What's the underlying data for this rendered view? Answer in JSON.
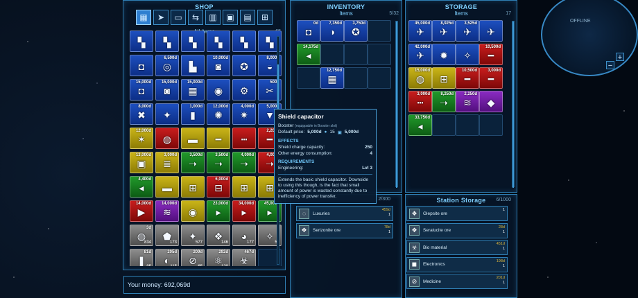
{
  "shop": {
    "title": "SHOP",
    "subtitle": "All items",
    "count": "65",
    "tabs": [
      {
        "icon": "grid-icon",
        "glyph": "▦"
      },
      {
        "icon": "ship-icon",
        "glyph": "➤"
      },
      {
        "icon": "gun-icon",
        "glyph": "▭"
      },
      {
        "icon": "arrows-icon",
        "glyph": "⇆"
      },
      {
        "icon": "engine-icon",
        "glyph": "▥"
      },
      {
        "icon": "boxes-icon",
        "glyph": "▣"
      },
      {
        "icon": "bars-icon",
        "glyph": "▤"
      },
      {
        "icon": "crates-icon",
        "glyph": "⊞"
      }
    ],
    "items": [
      {
        "color": "blue",
        "price": "",
        "icon": "▚",
        "qty": ""
      },
      {
        "color": "blue",
        "price": "",
        "icon": "▚",
        "qty": ""
      },
      {
        "color": "blue",
        "price": "",
        "icon": "▚",
        "qty": ""
      },
      {
        "color": "blue",
        "price": "",
        "icon": "▚",
        "qty": ""
      },
      {
        "color": "blue",
        "price": "",
        "icon": "▚",
        "qty": ""
      },
      {
        "color": "blue",
        "price": "",
        "icon": "▚",
        "qty": ""
      },
      {
        "color": "blue",
        "price": "",
        "icon": "◘",
        "qty": ""
      },
      {
        "color": "blue",
        "price": "6,500d",
        "icon": "◎",
        "qty": ""
      },
      {
        "color": "blue",
        "price": "",
        "icon": "▙",
        "qty": ""
      },
      {
        "color": "blue",
        "price": "10,000d",
        "icon": "◙",
        "qty": ""
      },
      {
        "color": "blue",
        "price": "",
        "icon": "✪",
        "qty": ""
      },
      {
        "color": "blue",
        "price": "8,000d",
        "icon": "◒",
        "qty": ""
      },
      {
        "color": "blue",
        "price": "15,000d",
        "icon": "◘",
        "qty": ""
      },
      {
        "color": "blue",
        "price": "15,000d",
        "icon": "◙",
        "qty": ""
      },
      {
        "color": "blue",
        "price": "15,000d",
        "icon": "▦",
        "qty": ""
      },
      {
        "color": "blue",
        "price": "",
        "icon": "◉",
        "qty": ""
      },
      {
        "color": "blue",
        "price": "",
        "icon": "⚙",
        "qty": ""
      },
      {
        "color": "blue",
        "price": "500d",
        "icon": "✂",
        "qty": ""
      },
      {
        "color": "blue",
        "price": "8,000d",
        "icon": "✖",
        "qty": ""
      },
      {
        "color": "blue",
        "price": "",
        "icon": "✦",
        "qty": ""
      },
      {
        "color": "blue",
        "price": "1,000d",
        "icon": "▮",
        "qty": ""
      },
      {
        "color": "blue",
        "price": "12,000d",
        "icon": "✺",
        "qty": ""
      },
      {
        "color": "blue",
        "price": "4,000d",
        "icon": "✷",
        "qty": ""
      },
      {
        "color": "blue",
        "price": "5,000d",
        "icon": "▼",
        "qty": ""
      },
      {
        "color": "yellow",
        "price": "12,000d",
        "icon": "✶",
        "qty": ""
      },
      {
        "color": "red",
        "price": "",
        "icon": "◍",
        "qty": ""
      },
      {
        "color": "yellow",
        "price": "",
        "icon": "▬",
        "qty": ""
      },
      {
        "color": "yellow",
        "price": "",
        "icon": "━",
        "qty": ""
      },
      {
        "color": "red",
        "price": "",
        "icon": "┅",
        "qty": ""
      },
      {
        "color": "red",
        "price": "2,200d",
        "icon": "━",
        "qty": ""
      },
      {
        "color": "yellow",
        "price": "13,000d",
        "icon": "▣",
        "qty": ""
      },
      {
        "color": "yellow",
        "price": "3,000d",
        "icon": "≣",
        "qty": ""
      },
      {
        "color": "green",
        "price": "3,500d",
        "icon": "➝",
        "qty": ""
      },
      {
        "color": "green",
        "price": "3,500d",
        "icon": "➝",
        "qty": ""
      },
      {
        "color": "green",
        "price": "4,000d",
        "icon": "➝",
        "qty": ""
      },
      {
        "color": "red",
        "price": "4,000d",
        "icon": "➝",
        "qty": ""
      },
      {
        "color": "green",
        "price": "4,400d",
        "icon": "◂",
        "qty": ""
      },
      {
        "color": "yellow",
        "price": "",
        "icon": "▬",
        "qty": ""
      },
      {
        "color": "yellow",
        "price": "",
        "icon": "⊞",
        "qty": ""
      },
      {
        "color": "red",
        "price": "6,000d",
        "icon": "⊟",
        "qty": ""
      },
      {
        "color": "yellow",
        "price": "",
        "icon": "⊞",
        "qty": ""
      },
      {
        "color": "yellow",
        "price": "",
        "icon": "⊞",
        "qty": ""
      },
      {
        "color": "red",
        "price": "14,000d",
        "icon": "▶",
        "qty": ""
      },
      {
        "color": "purple",
        "price": "14,000d",
        "icon": "≋",
        "qty": ""
      },
      {
        "color": "yellow",
        "price": "",
        "icon": "◉",
        "qty": ""
      },
      {
        "color": "green",
        "price": "23,000d",
        "icon": "▸",
        "qty": ""
      },
      {
        "color": "red",
        "price": "34,000d",
        "icon": "▸",
        "qty": ""
      },
      {
        "color": "green",
        "price": "45,000d",
        "icon": "▸",
        "qty": ""
      },
      {
        "color": "gray",
        "price": "3d",
        "icon": "◍",
        "qty": "834"
      },
      {
        "color": "gray",
        "price": "",
        "icon": "⬟",
        "qty": "173"
      },
      {
        "color": "gray",
        "price": "",
        "icon": "✦",
        "qty": "577"
      },
      {
        "color": "gray",
        "price": "",
        "icon": "❖",
        "qty": "146"
      },
      {
        "color": "gray",
        "price": "",
        "icon": "◕",
        "qty": "177"
      },
      {
        "color": "gray",
        "price": "",
        "icon": "✧",
        "qty": "57"
      },
      {
        "color": "gray",
        "price": "81d",
        "icon": "❚",
        "qty": "95"
      },
      {
        "color": "gray",
        "price": "205d",
        "icon": "◐",
        "qty": "115"
      },
      {
        "color": "gray",
        "price": "209d",
        "icon": "⊘",
        "qty": "65"
      },
      {
        "color": "gray",
        "price": "292d",
        "icon": "⚛",
        "qty": "120"
      },
      {
        "color": "gray",
        "price": "467d",
        "icon": "☣",
        "qty": ""
      },
      {
        "color": "empty",
        "price": "",
        "icon": "",
        "qty": ""
      }
    ]
  },
  "inventory": {
    "title": "INVENTORY",
    "subtitle": "Items",
    "count": "5/32",
    "items": [
      {
        "color": "blue",
        "price": "0d",
        "icon": "◘",
        "qty": ""
      },
      {
        "color": "blue",
        "price": "7,350d",
        "icon": "◑",
        "qty": ""
      },
      {
        "color": "blue",
        "price": "3,750d",
        "icon": "✪",
        "qty": ""
      },
      {
        "color": "empty",
        "price": "",
        "icon": "",
        "qty": ""
      },
      {
        "color": "green",
        "price": "14,175d",
        "icon": "◂",
        "qty": ""
      },
      {
        "color": "empty",
        "price": "",
        "icon": "",
        "qty": ""
      },
      {
        "color": "empty",
        "price": "",
        "icon": "",
        "qty": ""
      },
      {
        "color": "empty",
        "price": "",
        "icon": "",
        "qty": ""
      },
      {
        "color": "empty",
        "price": "",
        "icon": "",
        "qty": ""
      },
      {
        "color": "blue",
        "price": "12,750d",
        "icon": "▦",
        "qty": ""
      },
      {
        "color": "empty",
        "price": "",
        "icon": "",
        "qty": ""
      },
      {
        "color": "empty",
        "price": "",
        "icon": "",
        "qty": ""
      }
    ],
    "cargo_count": "2/300",
    "cargo": [
      {
        "icon": "luxury-icon",
        "glyph": "◌",
        "name": "Luxuries",
        "amount": "459d",
        "qty": "1"
      },
      {
        "icon": "ore-icon",
        "glyph": "❖",
        "name": "Serizonite ore",
        "amount": "78d",
        "qty": "1"
      }
    ]
  },
  "storage": {
    "title": "STORAGE",
    "subtitle": "Items",
    "count": "17",
    "items": [
      {
        "color": "blue",
        "price": "45,000d",
        "icon": "✈",
        "qty": ""
      },
      {
        "color": "blue",
        "price": "8,925d",
        "icon": "✈",
        "qty": ""
      },
      {
        "color": "blue",
        "price": "3,525d",
        "icon": "✈",
        "qty": ""
      },
      {
        "color": "blue",
        "price": "",
        "icon": "✈",
        "qty": ""
      },
      {
        "color": "blue",
        "price": "42,000d",
        "icon": "✈",
        "qty": ""
      },
      {
        "color": "blue",
        "price": "",
        "icon": "✹",
        "qty": ""
      },
      {
        "color": "blue",
        "price": "",
        "icon": "✧",
        "qty": ""
      },
      {
        "color": "red",
        "price": "10,500d",
        "icon": "━",
        "qty": ""
      },
      {
        "color": "yellow",
        "price": "15,000d",
        "icon": "◍",
        "qty": ""
      },
      {
        "color": "yellow",
        "price": "",
        "icon": "⊞",
        "qty": ""
      },
      {
        "color": "red",
        "price": "10,500d",
        "icon": "━",
        "qty": ""
      },
      {
        "color": "red",
        "price": "3,000d",
        "icon": "━",
        "qty": ""
      },
      {
        "color": "red",
        "price": "3,000d",
        "icon": "┅",
        "qty": ""
      },
      {
        "color": "green",
        "price": "8,250d",
        "icon": "➝",
        "qty": ""
      },
      {
        "color": "purple",
        "price": "2,250d",
        "icon": "≋",
        "qty": ""
      },
      {
        "color": "purple",
        "price": "",
        "icon": "◆",
        "qty": ""
      },
      {
        "color": "green",
        "price": "33,750d",
        "icon": "◂",
        "qty": ""
      },
      {
        "color": "empty",
        "price": "",
        "icon": "",
        "qty": ""
      },
      {
        "color": "empty",
        "price": "",
        "icon": "",
        "qty": ""
      },
      {
        "color": "empty",
        "price": "",
        "icon": "",
        "qty": ""
      }
    ]
  },
  "station_storage": {
    "title": "Station Storage",
    "count": "6/1000",
    "items": [
      {
        "icon": "ore-icon",
        "glyph": "❖",
        "name": "Glepsite ore",
        "amount": "",
        "qty": "1"
      },
      {
        "icon": "ore-icon",
        "glyph": "❖",
        "name": "Seralucite ore",
        "amount": "28d",
        "qty": "1"
      },
      {
        "icon": "bio-icon",
        "glyph": "☣",
        "name": "Bio material",
        "amount": "451d",
        "qty": "1"
      },
      {
        "icon": "chip-icon",
        "glyph": "◼",
        "name": "Electronics",
        "amount": "198d",
        "qty": "1"
      },
      {
        "icon": "pill-icon",
        "glyph": "⊘",
        "name": "Medicine",
        "amount": "201d",
        "qty": "1"
      }
    ]
  },
  "tooltip": {
    "title": "Shield capacitor",
    "type_label": "Booster",
    "type_note": "(equippable in Booster slot)",
    "price_label": "Default price:",
    "price": "5,000d",
    "level": "15",
    "alt_price": "5,000d",
    "effects_label": "EFFECTS",
    "effects": [
      {
        "name": "Shield charge capacity:",
        "value": "250"
      },
      {
        "name": "Other energy consumption:",
        "value": "4"
      }
    ],
    "requirements_label": "REQUIREMENTS",
    "requirements": [
      {
        "name": "Engineering:",
        "value": "Lvl 3"
      }
    ],
    "description": "Extends the basic shield capacitor. Downside to using this though, is the fact that small amount of power is wasted constantly due to inefficiency of power transfer."
  },
  "money": {
    "label": "Your money:",
    "value": "692,069d"
  },
  "radar": {
    "status": "OFFLINE",
    "zoom_in": "+",
    "zoom_out": "−"
  }
}
